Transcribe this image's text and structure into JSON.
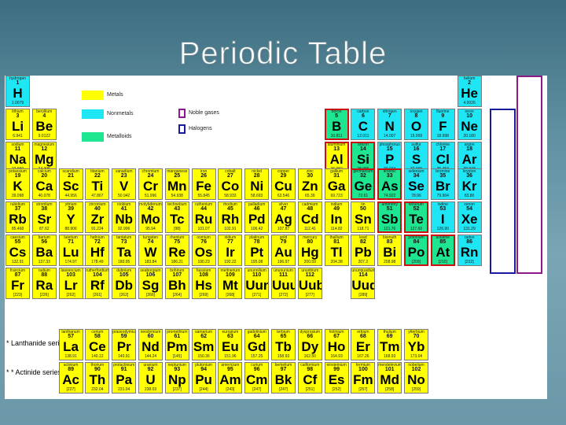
{
  "title": "Periodic Table",
  "legend": {
    "metals": "Metals",
    "nonmetals": "Nonmetals",
    "metalloids": "Metalloids",
    "noble_gases": "Noble gases",
    "halogens": "Halogens"
  },
  "colors": {
    "metal": "#ffff00",
    "nonmetal": "#1ee6f5",
    "metalloid": "#1ee690",
    "noble_gases": "#8b1a8b",
    "halogens": "#1a1aa0",
    "highlight": "#d01010"
  },
  "series": {
    "lanthanides": "* Lanthanide series",
    "actinides": "* * Actinide series",
    "lanthanide_range": "57-70",
    "actinide_range": "89-102",
    "lanthanide_mark": "*",
    "actinide_mark": "* *"
  },
  "elements": [
    {
      "n": 1,
      "s": "H",
      "name": "hydrogen",
      "m": "1.0079",
      "c": "nonmetal",
      "r": 1,
      "g": 1
    },
    {
      "n": 2,
      "s": "He",
      "name": "helium",
      "m": "4.0026",
      "c": "nonmetal",
      "r": 1,
      "g": 18
    },
    {
      "n": 3,
      "s": "Li",
      "name": "lithium",
      "m": "6.941",
      "c": "metal",
      "r": 2,
      "g": 1
    },
    {
      "n": 4,
      "s": "Be",
      "name": "beryllium",
      "m": "9.0122",
      "c": "metal",
      "r": 2,
      "g": 2
    },
    {
      "n": 5,
      "s": "B",
      "name": "boron",
      "m": "10.811",
      "c": "metalloid",
      "r": 2,
      "g": 13
    },
    {
      "n": 6,
      "s": "C",
      "name": "carbon",
      "m": "12.011",
      "c": "nonmetal",
      "r": 2,
      "g": 14
    },
    {
      "n": 7,
      "s": "N",
      "name": "nitrogen",
      "m": "14.007",
      "c": "nonmetal",
      "r": 2,
      "g": 15
    },
    {
      "n": 8,
      "s": "O",
      "name": "oxygen",
      "m": "15.999",
      "c": "nonmetal",
      "r": 2,
      "g": 16
    },
    {
      "n": 9,
      "s": "F",
      "name": "fluorine",
      "m": "18.998",
      "c": "nonmetal",
      "r": 2,
      "g": 17
    },
    {
      "n": 10,
      "s": "Ne",
      "name": "neon",
      "m": "20.180",
      "c": "nonmetal",
      "r": 2,
      "g": 18
    },
    {
      "n": 11,
      "s": "Na",
      "name": "sodium",
      "m": "22.990",
      "c": "metal",
      "r": 3,
      "g": 1
    },
    {
      "n": 12,
      "s": "Mg",
      "name": "magnesium",
      "m": "24.305",
      "c": "metal",
      "r": 3,
      "g": 2
    },
    {
      "n": 13,
      "s": "Al",
      "name": "aluminium",
      "m": "26.982",
      "c": "metal",
      "r": 3,
      "g": 13
    },
    {
      "n": 14,
      "s": "Si",
      "name": "silicon",
      "m": "28.086",
      "c": "metalloid",
      "r": 3,
      "g": 14
    },
    {
      "n": 15,
      "s": "P",
      "name": "phosphorus",
      "m": "30.974",
      "c": "nonmetal",
      "r": 3,
      "g": 15
    },
    {
      "n": 16,
      "s": "S",
      "name": "sulfur",
      "m": "32.065",
      "c": "nonmetal",
      "r": 3,
      "g": 16
    },
    {
      "n": 17,
      "s": "Cl",
      "name": "chlorine",
      "m": "35.453",
      "c": "nonmetal",
      "r": 3,
      "g": 17
    },
    {
      "n": 18,
      "s": "Ar",
      "name": "argon",
      "m": "39.948",
      "c": "nonmetal",
      "r": 3,
      "g": 18
    },
    {
      "n": 19,
      "s": "K",
      "name": "potassium",
      "m": "39.098",
      "c": "metal",
      "r": 4,
      "g": 1
    },
    {
      "n": 20,
      "s": "Ca",
      "name": "calcium",
      "m": "40.078",
      "c": "metal",
      "r": 4,
      "g": 2
    },
    {
      "n": 21,
      "s": "Sc",
      "name": "scandium",
      "m": "44.956",
      "c": "metal",
      "r": 4,
      "g": 3
    },
    {
      "n": 22,
      "s": "Ti",
      "name": "titanium",
      "m": "47.867",
      "c": "metal",
      "r": 4,
      "g": 4
    },
    {
      "n": 23,
      "s": "V",
      "name": "vanadium",
      "m": "50.942",
      "c": "metal",
      "r": 4,
      "g": 5
    },
    {
      "n": 24,
      "s": "Cr",
      "name": "chromium",
      "m": "51.996",
      "c": "metal",
      "r": 4,
      "g": 6
    },
    {
      "n": 25,
      "s": "Mn",
      "name": "manganese",
      "m": "54.938",
      "c": "metal",
      "r": 4,
      "g": 7
    },
    {
      "n": 26,
      "s": "Fe",
      "name": "iron",
      "m": "55.845",
      "c": "metal",
      "r": 4,
      "g": 8
    },
    {
      "n": 27,
      "s": "Co",
      "name": "cobalt",
      "m": "58.933",
      "c": "metal",
      "r": 4,
      "g": 9
    },
    {
      "n": 28,
      "s": "Ni",
      "name": "nickel",
      "m": "58.693",
      "c": "metal",
      "r": 4,
      "g": 10
    },
    {
      "n": 29,
      "s": "Cu",
      "name": "copper",
      "m": "63.546",
      "c": "metal",
      "r": 4,
      "g": 11
    },
    {
      "n": 30,
      "s": "Zn",
      "name": "zinc",
      "m": "65.39",
      "c": "metal",
      "r": 4,
      "g": 12
    },
    {
      "n": 31,
      "s": "Ga",
      "name": "gallium",
      "m": "69.723",
      "c": "metal",
      "r": 4,
      "g": 13
    },
    {
      "n": 32,
      "s": "Ge",
      "name": "germanium",
      "m": "72.61",
      "c": "metalloid",
      "r": 4,
      "g": 14
    },
    {
      "n": 33,
      "s": "As",
      "name": "arsenic",
      "m": "74.922",
      "c": "metalloid",
      "r": 4,
      "g": 15
    },
    {
      "n": 34,
      "s": "Se",
      "name": "selenium",
      "m": "78.96",
      "c": "nonmetal",
      "r": 4,
      "g": 16
    },
    {
      "n": 35,
      "s": "Br",
      "name": "bromine",
      "m": "79.904",
      "c": "nonmetal",
      "r": 4,
      "g": 17
    },
    {
      "n": 36,
      "s": "Kr",
      "name": "krypton",
      "m": "83.80",
      "c": "nonmetal",
      "r": 4,
      "g": 18
    },
    {
      "n": 37,
      "s": "Rb",
      "name": "rubidium",
      "m": "85.468",
      "c": "metal",
      "r": 5,
      "g": 1
    },
    {
      "n": 38,
      "s": "Sr",
      "name": "strontium",
      "m": "87.62",
      "c": "metal",
      "r": 5,
      "g": 2
    },
    {
      "n": 39,
      "s": "Y",
      "name": "yttrium",
      "m": "88.906",
      "c": "metal",
      "r": 5,
      "g": 3
    },
    {
      "n": 40,
      "s": "Zr",
      "name": "zirconium",
      "m": "91.224",
      "c": "metal",
      "r": 5,
      "g": 4
    },
    {
      "n": 41,
      "s": "Nb",
      "name": "niobium",
      "m": "92.906",
      "c": "metal",
      "r": 5,
      "g": 5
    },
    {
      "n": 42,
      "s": "Mo",
      "name": "molybdenum",
      "m": "95.94",
      "c": "metal",
      "r": 5,
      "g": 6
    },
    {
      "n": 43,
      "s": "Tc",
      "name": "technetium",
      "m": "[98]",
      "c": "metal",
      "r": 5,
      "g": 7
    },
    {
      "n": 44,
      "s": "Ru",
      "name": "ruthenium",
      "m": "101.07",
      "c": "metal",
      "r": 5,
      "g": 8
    },
    {
      "n": 45,
      "s": "Rh",
      "name": "rhodium",
      "m": "102.91",
      "c": "metal",
      "r": 5,
      "g": 9
    },
    {
      "n": 46,
      "s": "Pd",
      "name": "palladium",
      "m": "106.42",
      "c": "metal",
      "r": 5,
      "g": 10
    },
    {
      "n": 47,
      "s": "Ag",
      "name": "silver",
      "m": "107.87",
      "c": "metal",
      "r": 5,
      "g": 11
    },
    {
      "n": 48,
      "s": "Cd",
      "name": "cadmium",
      "m": "112.41",
      "c": "metal",
      "r": 5,
      "g": 12
    },
    {
      "n": 49,
      "s": "In",
      "name": "indium",
      "m": "114.82",
      "c": "metal",
      "r": 5,
      "g": 13
    },
    {
      "n": 50,
      "s": "Sn",
      "name": "tin",
      "m": "118.71",
      "c": "metal",
      "r": 5,
      "g": 14
    },
    {
      "n": 51,
      "s": "Sb",
      "name": "antimony",
      "m": "121.76",
      "c": "metalloid",
      "r": 5,
      "g": 15
    },
    {
      "n": 52,
      "s": "Te",
      "name": "tellurium",
      "m": "127.60",
      "c": "metalloid",
      "r": 5,
      "g": 16
    },
    {
      "n": 53,
      "s": "I",
      "name": "iodine",
      "m": "126.90",
      "c": "nonmetal",
      "r": 5,
      "g": 17
    },
    {
      "n": 54,
      "s": "Xe",
      "name": "xenon",
      "m": "131.29",
      "c": "nonmetal",
      "r": 5,
      "g": 18
    },
    {
      "n": 55,
      "s": "Cs",
      "name": "caesium",
      "m": "132.91",
      "c": "metal",
      "r": 6,
      "g": 1
    },
    {
      "n": 56,
      "s": "Ba",
      "name": "barium",
      "m": "137.33",
      "c": "metal",
      "r": 6,
      "g": 2
    },
    {
      "n": 71,
      "s": "Lu",
      "name": "lutetium",
      "m": "174.97",
      "c": "metal",
      "r": 6,
      "g": 3
    },
    {
      "n": 72,
      "s": "Hf",
      "name": "hafnium",
      "m": "178.49",
      "c": "metal",
      "r": 6,
      "g": 4
    },
    {
      "n": 73,
      "s": "Ta",
      "name": "tantalum",
      "m": "180.95",
      "c": "metal",
      "r": 6,
      "g": 5
    },
    {
      "n": 74,
      "s": "W",
      "name": "tungsten",
      "m": "183.84",
      "c": "metal",
      "r": 6,
      "g": 6
    },
    {
      "n": 75,
      "s": "Re",
      "name": "rhenium",
      "m": "186.21",
      "c": "metal",
      "r": 6,
      "g": 7
    },
    {
      "n": 76,
      "s": "Os",
      "name": "osmium",
      "m": "190.23",
      "c": "metal",
      "r": 6,
      "g": 8
    },
    {
      "n": 77,
      "s": "Ir",
      "name": "iridium",
      "m": "192.22",
      "c": "metal",
      "r": 6,
      "g": 9
    },
    {
      "n": 78,
      "s": "Pt",
      "name": "platinum",
      "m": "195.08",
      "c": "metal",
      "r": 6,
      "g": 10
    },
    {
      "n": 79,
      "s": "Au",
      "name": "gold",
      "m": "196.97",
      "c": "metal",
      "r": 6,
      "g": 11
    },
    {
      "n": 80,
      "s": "Hg",
      "name": "mercury",
      "m": "200.59",
      "c": "metal",
      "r": 6,
      "g": 12
    },
    {
      "n": 81,
      "s": "Tl",
      "name": "thallium",
      "m": "204.38",
      "c": "metal",
      "r": 6,
      "g": 13
    },
    {
      "n": 82,
      "s": "Pb",
      "name": "lead",
      "m": "207.2",
      "c": "metal",
      "r": 6,
      "g": 14
    },
    {
      "n": 83,
      "s": "Bi",
      "name": "bismuth",
      "m": "208.98",
      "c": "metal",
      "r": 6,
      "g": 15
    },
    {
      "n": 84,
      "s": "Po",
      "name": "polonium",
      "m": "[209]",
      "c": "metalloid",
      "r": 6,
      "g": 16
    },
    {
      "n": 85,
      "s": "At",
      "name": "astatine",
      "m": "[210]",
      "c": "metalloid",
      "r": 6,
      "g": 17
    },
    {
      "n": 86,
      "s": "Rn",
      "name": "radon",
      "m": "[222]",
      "c": "nonmetal",
      "r": 6,
      "g": 18
    },
    {
      "n": 87,
      "s": "Fr",
      "name": "francium",
      "m": "[223]",
      "c": "metal",
      "r": 7,
      "g": 1
    },
    {
      "n": 88,
      "s": "Ra",
      "name": "radium",
      "m": "[226]",
      "c": "metal",
      "r": 7,
      "g": 2
    },
    {
      "n": 103,
      "s": "Lr",
      "name": "lawrencium",
      "m": "[262]",
      "c": "metal",
      "r": 7,
      "g": 3
    },
    {
      "n": 104,
      "s": "Rf",
      "name": "rutherfordium",
      "m": "[261]",
      "c": "metal",
      "r": 7,
      "g": 4
    },
    {
      "n": 105,
      "s": "Db",
      "name": "dubnium",
      "m": "[262]",
      "c": "metal",
      "r": 7,
      "g": 5
    },
    {
      "n": 106,
      "s": "Sg",
      "name": "seaborgium",
      "m": "[266]",
      "c": "metal",
      "r": 7,
      "g": 6
    },
    {
      "n": 107,
      "s": "Bh",
      "name": "bohrium",
      "m": "[264]",
      "c": "metal",
      "r": 7,
      "g": 7
    },
    {
      "n": 108,
      "s": "Hs",
      "name": "hassium",
      "m": "[269]",
      "c": "metal",
      "r": 7,
      "g": 8
    },
    {
      "n": 109,
      "s": "Mt",
      "name": "meitnerium",
      "m": "[268]",
      "c": "metal",
      "r": 7,
      "g": 9
    },
    {
      "n": 110,
      "s": "Uun",
      "name": "ununnilium",
      "m": "[271]",
      "c": "metal",
      "r": 7,
      "g": 10
    },
    {
      "n": 111,
      "s": "Uuu",
      "name": "unununium",
      "m": "[272]",
      "c": "metal",
      "r": 7,
      "g": 11
    },
    {
      "n": 112,
      "s": "Uub",
      "name": "ununbium",
      "m": "[277]",
      "c": "metal",
      "r": 7,
      "g": 12
    },
    {
      "n": 114,
      "s": "Uuq",
      "name": "ununquadium",
      "m": "[289]",
      "c": "metal",
      "r": 7,
      "g": 14
    },
    {
      "n": 57,
      "s": "La",
      "name": "lanthanum",
      "m": "138.91",
      "c": "metal",
      "r": 9,
      "g": 3
    },
    {
      "n": 58,
      "s": "Ce",
      "name": "cerium",
      "m": "140.12",
      "c": "metal",
      "r": 9,
      "g": 4
    },
    {
      "n": 59,
      "s": "Pr",
      "name": "praseodymium",
      "m": "140.91",
      "c": "metal",
      "r": 9,
      "g": 5
    },
    {
      "n": 60,
      "s": "Nd",
      "name": "neodymium",
      "m": "144.24",
      "c": "metal",
      "r": 9,
      "g": 6
    },
    {
      "n": 61,
      "s": "Pm",
      "name": "promethium",
      "m": "[145]",
      "c": "metal",
      "r": 9,
      "g": 7
    },
    {
      "n": 62,
      "s": "Sm",
      "name": "samarium",
      "m": "150.36",
      "c": "metal",
      "r": 9,
      "g": 8
    },
    {
      "n": 63,
      "s": "Eu",
      "name": "europium",
      "m": "151.96",
      "c": "metal",
      "r": 9,
      "g": 9
    },
    {
      "n": 64,
      "s": "Gd",
      "name": "gadolinium",
      "m": "157.25",
      "c": "metal",
      "r": 9,
      "g": 10
    },
    {
      "n": 65,
      "s": "Tb",
      "name": "terbium",
      "m": "158.93",
      "c": "metal",
      "r": 9,
      "g": 11
    },
    {
      "n": 66,
      "s": "Dy",
      "name": "dysprosium",
      "m": "162.50",
      "c": "metal",
      "r": 9,
      "g": 12
    },
    {
      "n": 67,
      "s": "Ho",
      "name": "holmium",
      "m": "164.93",
      "c": "metal",
      "r": 9,
      "g": 13
    },
    {
      "n": 68,
      "s": "Er",
      "name": "erbium",
      "m": "167.26",
      "c": "metal",
      "r": 9,
      "g": 14
    },
    {
      "n": 69,
      "s": "Tm",
      "name": "thulium",
      "m": "168.93",
      "c": "metal",
      "r": 9,
      "g": 15
    },
    {
      "n": 70,
      "s": "Yb",
      "name": "ytterbium",
      "m": "173.04",
      "c": "metal",
      "r": 9,
      "g": 16
    },
    {
      "n": 89,
      "s": "Ac",
      "name": "actinium",
      "m": "[227]",
      "c": "metal",
      "r": 10,
      "g": 3
    },
    {
      "n": 90,
      "s": "Th",
      "name": "thorium",
      "m": "232.04",
      "c": "metal",
      "r": 10,
      "g": 4
    },
    {
      "n": 91,
      "s": "Pa",
      "name": "protactinium",
      "m": "231.04",
      "c": "metal",
      "r": 10,
      "g": 5
    },
    {
      "n": 92,
      "s": "U",
      "name": "uranium",
      "m": "238.03",
      "c": "metal",
      "r": 10,
      "g": 6
    },
    {
      "n": 93,
      "s": "Np",
      "name": "neptunium",
      "m": "[237]",
      "c": "metal",
      "r": 10,
      "g": 7
    },
    {
      "n": 94,
      "s": "Pu",
      "name": "plutonium",
      "m": "[244]",
      "c": "metal",
      "r": 10,
      "g": 8
    },
    {
      "n": 95,
      "s": "Am",
      "name": "americium",
      "m": "[243]",
      "c": "metal",
      "r": 10,
      "g": 9
    },
    {
      "n": 96,
      "s": "Cm",
      "name": "curium",
      "m": "[247]",
      "c": "metal",
      "r": 10,
      "g": 10
    },
    {
      "n": 97,
      "s": "Bk",
      "name": "berkelium",
      "m": "[247]",
      "c": "metal",
      "r": 10,
      "g": 11
    },
    {
      "n": 98,
      "s": "Cf",
      "name": "californium",
      "m": "[251]",
      "c": "metal",
      "r": 10,
      "g": 12
    },
    {
      "n": 99,
      "s": "Es",
      "name": "einsteinium",
      "m": "[252]",
      "c": "metal",
      "r": 10,
      "g": 13
    },
    {
      "n": 100,
      "s": "Fm",
      "name": "fermium",
      "m": "[257]",
      "c": "metal",
      "r": 10,
      "g": 14
    },
    {
      "n": 101,
      "s": "Md",
      "name": "mendelevium",
      "m": "[258]",
      "c": "metal",
      "r": 10,
      "g": 15
    },
    {
      "n": 102,
      "s": "No",
      "name": "nobelium",
      "m": "[259]",
      "c": "metal",
      "r": 10,
      "g": 16
    }
  ],
  "highlighted": [
    5,
    13,
    14,
    32,
    33,
    51,
    52,
    84,
    85
  ]
}
